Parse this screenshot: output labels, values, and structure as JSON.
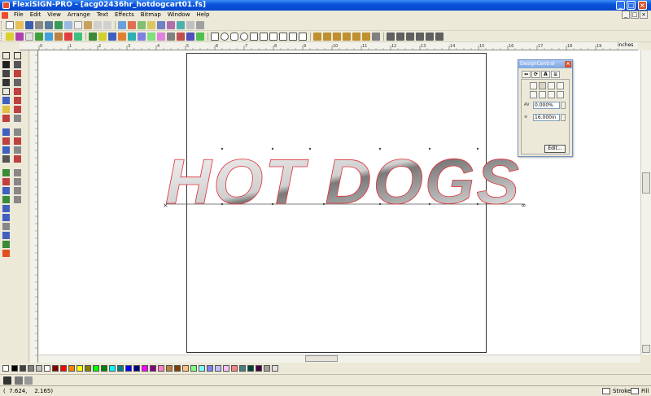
{
  "window": {
    "title": "FlexiSIGN-PRO - [acg02436hr_hotdogcart01.fs]",
    "minimize": "_",
    "maximize": "□",
    "close": "×"
  },
  "menu": [
    "File",
    "Edit",
    "View",
    "Arrange",
    "Text",
    "Effects",
    "Bitmap",
    "Window",
    "Help"
  ],
  "mdi_buttons": [
    "_",
    "□",
    "×"
  ],
  "ruler": {
    "unit_label": "inches",
    "h_ticks": [
      "0",
      "1",
      "2",
      "3",
      "4",
      "5",
      "6",
      "7",
      "8",
      "9",
      "10",
      "11",
      "12",
      "13",
      "14",
      "15",
      "16",
      "17",
      "18",
      "19",
      "20"
    ]
  },
  "canvas": {
    "artwork_text": "HOT DOGS",
    "outline_color": "#e0303a",
    "fill_dark": "#7a7a7a",
    "fill_light": "#f4f4f4"
  },
  "design_central": {
    "title": "DesignCentral",
    "close": "×",
    "tabs": [
      "↔",
      "⟳",
      "A",
      "≡"
    ],
    "fields": [
      {
        "label": "AV",
        "value": "0.000%"
      },
      {
        "label": "≡",
        "value": "16.000in"
      }
    ],
    "edit_label": "Edit..."
  },
  "status": {
    "coords": "(  7.624,    2.165)",
    "stroke_label": "Stroke",
    "fill_label": "Fill"
  },
  "palette_colors": [
    "#000000",
    "#404040",
    "#808080",
    "#c0c0c0",
    "#ffffff",
    "#800000",
    "#ff0000",
    "#ff8000",
    "#ffff00",
    "#808000",
    "#00ff00",
    "#008000",
    "#00ffff",
    "#008080",
    "#0000ff",
    "#000080",
    "#ff00ff",
    "#800080",
    "#ff80c0",
    "#c08040",
    "#804000",
    "#ffc080",
    "#80ff80",
    "#80ffff",
    "#8080ff",
    "#c0c0ff",
    "#ffc0ff",
    "#ff8080",
    "#408080",
    "#004040",
    "#400040",
    "#a0a0a0",
    "#e0e0e0"
  ],
  "colors": {
    "title_blue": "#0a54dd",
    "chrome": "#ece9d8",
    "outline_red": "#e0303a"
  }
}
